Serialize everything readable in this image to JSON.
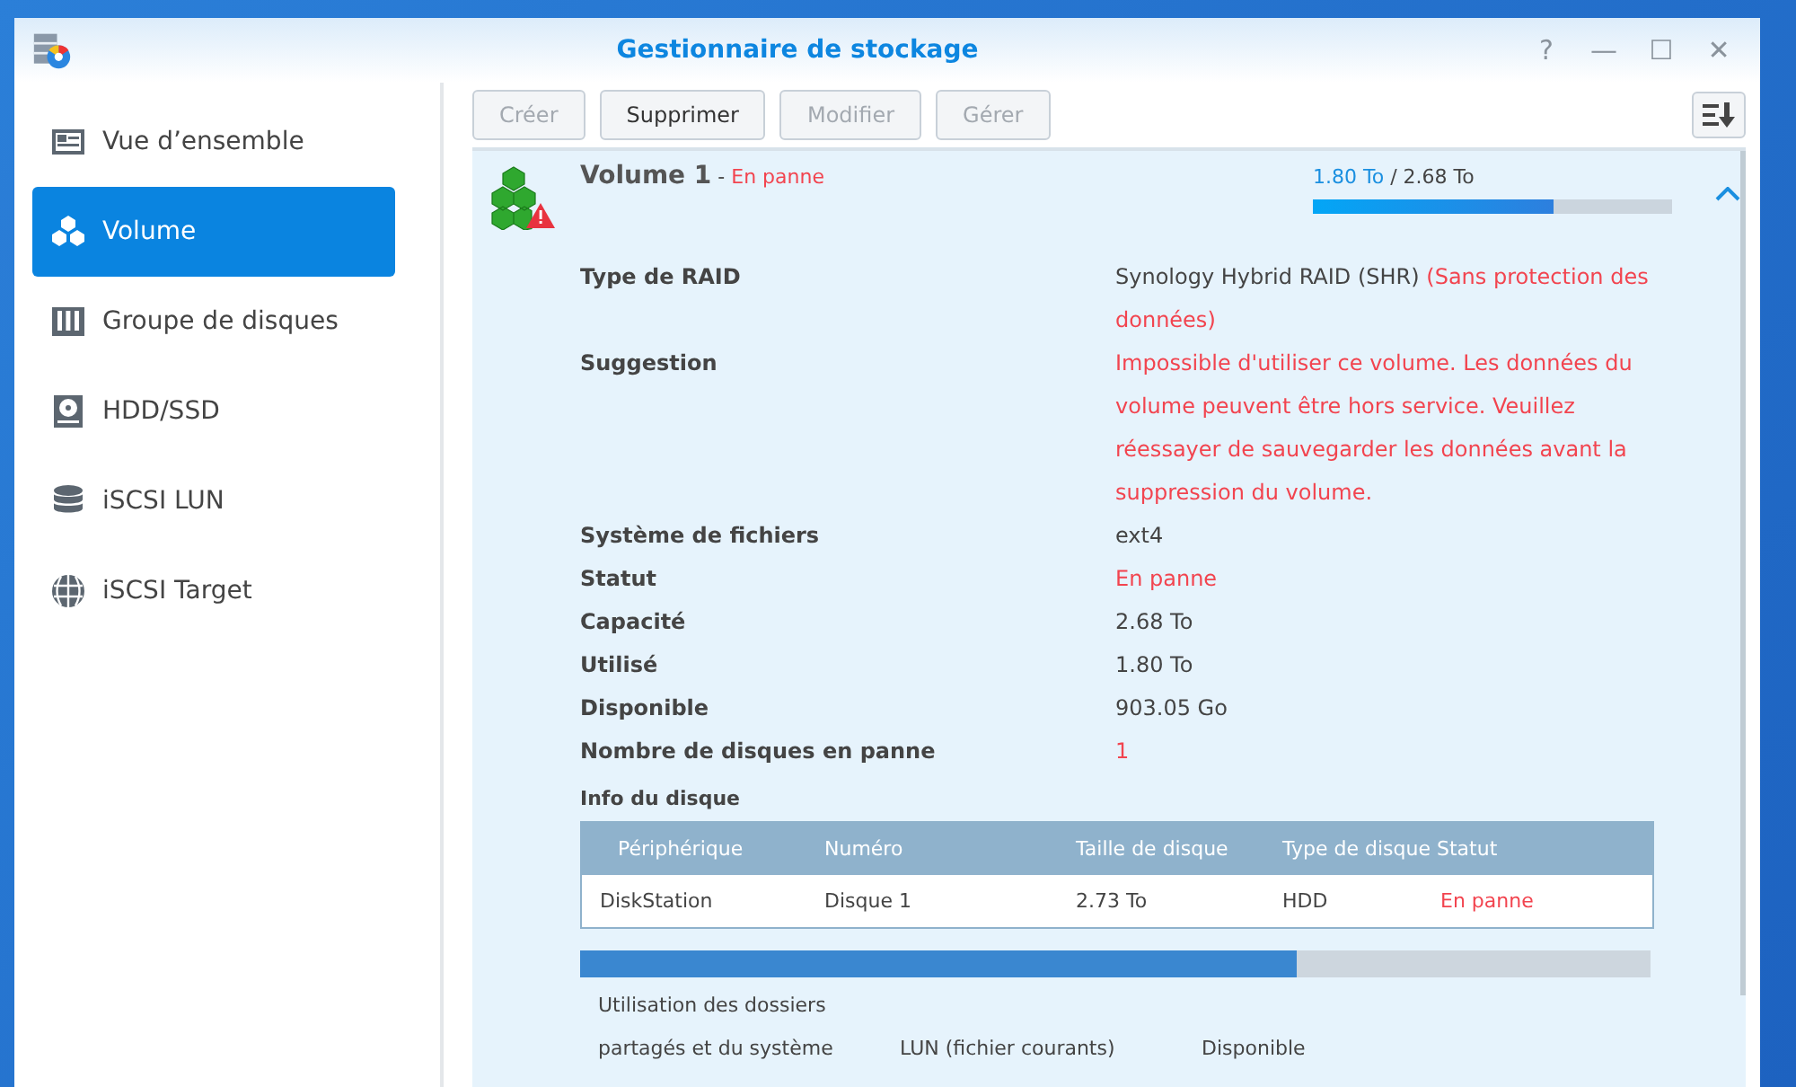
{
  "window": {
    "title": "Gestionnaire de stockage",
    "controls": [
      "?",
      "—",
      "☐",
      "✕"
    ]
  },
  "sidebar": {
    "items": [
      {
        "label": "Vue d’ensemble",
        "selected": false
      },
      {
        "label": "Volume",
        "selected": true
      },
      {
        "label": "Groupe de disques",
        "selected": false
      },
      {
        "label": "HDD/SSD",
        "selected": false
      },
      {
        "label": "iSCSI LUN",
        "selected": false
      },
      {
        "label": "iSCSI Target",
        "selected": false
      }
    ]
  },
  "toolbar": {
    "buttons": [
      {
        "label": "Créer",
        "disabled": true
      },
      {
        "label": "Supprimer",
        "disabled": false
      },
      {
        "label": "Modifier",
        "disabled": true
      },
      {
        "label": "Gérer",
        "disabled": true
      }
    ]
  },
  "volume": {
    "name": "Volume 1",
    "separator": " - ",
    "status": "En panne",
    "usage": "1.80 To",
    "total": " / 2.68 To",
    "level": 0.67,
    "expanded": true,
    "properties": [
      {
        "label": "Type de RAID",
        "parts": [
          {
            "text": "Synology Hybrid RAID (SHR) ",
            "alert": false
          },
          {
            "text": "(Sans protection des données)",
            "alert": true
          }
        ]
      },
      {
        "label": "Suggestion",
        "parts": [
          {
            "text": "Impossible d'utiliser ce volume. Les données du volume peuvent être hors service. Veuillez réessayer de sauvegarder les données avant la suppression du volume.",
            "alert": true
          }
        ]
      },
      {
        "label": "Système de fichiers",
        "parts": [
          {
            "text": "ext4",
            "alert": false
          }
        ]
      },
      {
        "label": "Statut",
        "parts": [
          {
            "text": "En panne",
            "alert": true
          }
        ]
      },
      {
        "label": "Capacité",
        "parts": [
          {
            "text": "2.68 To",
            "alert": false
          }
        ]
      },
      {
        "label": "Utilisé",
        "parts": [
          {
            "text": "1.80 To",
            "alert": false
          }
        ]
      },
      {
        "label": "Disponible",
        "parts": [
          {
            "text": "903.05 Go",
            "alert": false
          }
        ]
      },
      {
        "label": "Nombre de disques en panne",
        "parts": [
          {
            "text": "1",
            "alert": true
          }
        ]
      }
    ],
    "disk_info": {
      "title": "Info du disque",
      "columns": [
        "Périphérique",
        "Numéro",
        "Taille de disque",
        "Type de disque",
        "Statut"
      ],
      "rows": [
        {
          "cells": [
            {
              "text": "DiskStation",
              "alert": false
            },
            {
              "text": "Disque 1",
              "alert": false
            },
            {
              "text": "2.73 To",
              "alert": false
            },
            {
              "text": "HDD",
              "alert": false
            },
            {
              "text": "En panne",
              "alert": true
            }
          ]
        }
      ]
    },
    "breakdown": {
      "level": 0.67,
      "legend": [
        "Utilisation des dossiers partagés et du système",
        "LUN (fichier courants)",
        "Disponible"
      ]
    }
  }
}
